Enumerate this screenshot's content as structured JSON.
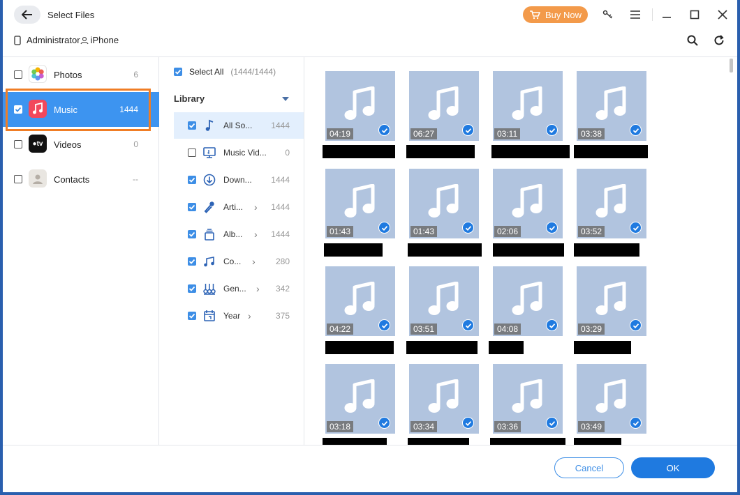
{
  "window": {
    "title": "Select Files",
    "buy_now": "Buy Now"
  },
  "device": {
    "computer": "Administrator",
    "phone": "iPhone"
  },
  "categories": [
    {
      "label": "Photos",
      "count": "6",
      "checked": false
    },
    {
      "label": "Music",
      "count": "1444",
      "checked": true,
      "selected": true
    },
    {
      "label": "Videos",
      "count": "0",
      "checked": false
    },
    {
      "label": "Contacts",
      "count": "--",
      "checked": false
    }
  ],
  "middle": {
    "select_all": "Select All",
    "select_all_count": "(1444/1444)",
    "library": "Library",
    "items": [
      {
        "label": "All So...",
        "count": "1444",
        "checked": true,
        "icon": "music-note-icon"
      },
      {
        "label": "Music Vid...",
        "count": "0",
        "checked": false,
        "icon": "music-video-icon"
      },
      {
        "label": "Down...",
        "count": "1444",
        "checked": true,
        "icon": "download-icon"
      },
      {
        "label": "Arti...",
        "count": "1444",
        "checked": true,
        "icon": "artist-microphone-icon",
        "chevron": "›"
      },
      {
        "label": "Alb...",
        "count": "1444",
        "checked": true,
        "icon": "album-icon",
        "chevron": "›"
      },
      {
        "label": "Co...",
        "count": "280",
        "checked": true,
        "icon": "composer-icon",
        "chevron": "›"
      },
      {
        "label": "Gen...",
        "count": "342",
        "checked": true,
        "icon": "genre-icon",
        "chevron": "›"
      },
      {
        "label": "Year",
        "count": "375",
        "checked": true,
        "icon": "calendar-icon",
        "chevron": "›"
      }
    ]
  },
  "songs": [
    {
      "duration": "04:19"
    },
    {
      "duration": "06:27"
    },
    {
      "duration": "03:11"
    },
    {
      "duration": "03:38"
    },
    {
      "duration": "01:43"
    },
    {
      "duration": "01:43"
    },
    {
      "duration": "02:06"
    },
    {
      "duration": "03:52"
    },
    {
      "duration": "04:22"
    },
    {
      "duration": "03:51"
    },
    {
      "duration": "04:08"
    },
    {
      "duration": "03:29"
    },
    {
      "duration": "03:18"
    },
    {
      "duration": "03:34"
    },
    {
      "duration": "03:36"
    },
    {
      "duration": "03:49"
    }
  ],
  "footer": {
    "cancel": "Cancel",
    "ok": "OK"
  },
  "colors": {
    "accent": "#3d94f0",
    "buy": "#f39a4a",
    "highlight": "#f07d25",
    "tile": "#b1c4df"
  }
}
